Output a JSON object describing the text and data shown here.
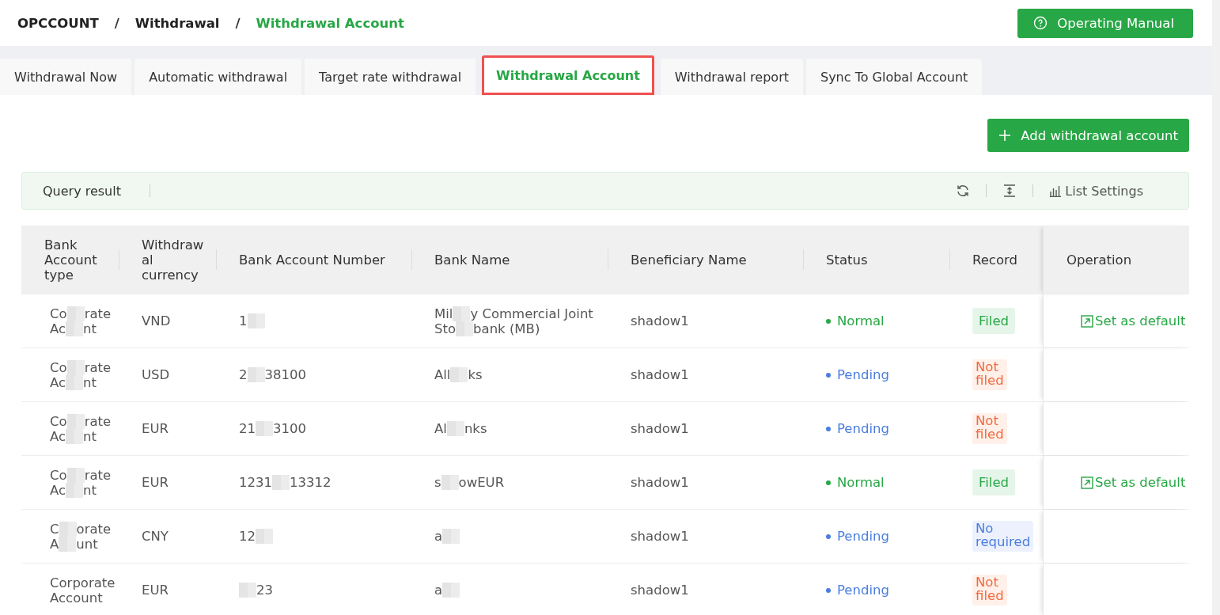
{
  "breadcrumb": [
    {
      "label": "OPCCOUNT",
      "selected": false
    },
    {
      "label": "Withdrawal",
      "selected": false
    },
    {
      "label": "Withdrawal Account",
      "selected": true
    }
  ],
  "breadcrumb_separator": "/",
  "manual_button": "Operating Manual",
  "tabs": [
    {
      "label": "Withdrawal Now",
      "selected": false,
      "highlighted": false
    },
    {
      "label": "Automatic withdrawal",
      "selected": false,
      "highlighted": false
    },
    {
      "label": "Target rate withdrawal",
      "selected": false,
      "highlighted": false
    },
    {
      "label": "Withdrawal Account",
      "selected": true,
      "highlighted": true
    },
    {
      "label": "Withdrawal report",
      "selected": false,
      "highlighted": false
    },
    {
      "label": "Sync To Global Account",
      "selected": false,
      "highlighted": false
    }
  ],
  "add_button": "Add withdrawal account",
  "toolbar": {
    "title": "Query result",
    "settings": "List Settings"
  },
  "table": {
    "columns": [
      [
        "Bank",
        "Account",
        "type"
      ],
      [
        "Withdraw",
        "al",
        "currency"
      ],
      [
        "Bank Account Number"
      ],
      [
        "Bank Name"
      ],
      [
        "Beneficiary Name"
      ],
      [
        "Status"
      ],
      [
        "Record"
      ],
      [
        "Operation"
      ]
    ],
    "rows": [
      {
        "type": [
          [
            {
              "kind": "text",
              "text": "Co"
            },
            {
              "kind": "redacted"
            },
            {
              "kind": "text",
              "text": "rate"
            }
          ],
          [
            {
              "kind": "text",
              "text": "Ac"
            },
            {
              "kind": "redacted"
            },
            {
              "kind": "text",
              "text": "nt"
            }
          ]
        ],
        "currency": "VND",
        "number": [
          [
            {
              "kind": "text",
              "text": "1"
            },
            {
              "kind": "redacted"
            }
          ]
        ],
        "bank": [
          [
            {
              "kind": "text",
              "text": "Mil"
            },
            {
              "kind": "redacted"
            },
            {
              "kind": "text",
              "text": "y Commercial Joint"
            }
          ],
          [
            {
              "kind": "text",
              "text": "Sto"
            },
            {
              "kind": "redacted"
            },
            {
              "kind": "text",
              "text": "bank (MB)"
            }
          ]
        ],
        "beneficiary": "shadow1",
        "status": {
          "kind": "normal",
          "label": "Normal"
        },
        "record": {
          "kind": "filed",
          "lines": [
            "Filed"
          ]
        },
        "operation": "Set as default"
      },
      {
        "type": [
          [
            {
              "kind": "text",
              "text": "Co"
            },
            {
              "kind": "redacted"
            },
            {
              "kind": "text",
              "text": "rate"
            }
          ],
          [
            {
              "kind": "text",
              "text": "Ac"
            },
            {
              "kind": "redacted"
            },
            {
              "kind": "text",
              "text": "nt"
            }
          ]
        ],
        "currency": "USD",
        "number": [
          [
            {
              "kind": "text",
              "text": "2"
            },
            {
              "kind": "redacted"
            },
            {
              "kind": "text",
              "text": "38100"
            }
          ]
        ],
        "bank": [
          [
            {
              "kind": "text",
              "text": "All"
            },
            {
              "kind": "redacted"
            },
            {
              "kind": "text",
              "text": "ks"
            }
          ]
        ],
        "beneficiary": "shadow1",
        "status": {
          "kind": "pending",
          "label": "Pending"
        },
        "record": {
          "kind": "not_filed",
          "lines": [
            "Not",
            "filed"
          ]
        }
      },
      {
        "type": [
          [
            {
              "kind": "text",
              "text": "Co"
            },
            {
              "kind": "redacted"
            },
            {
              "kind": "text",
              "text": "rate"
            }
          ],
          [
            {
              "kind": "text",
              "text": "Ac"
            },
            {
              "kind": "redacted"
            },
            {
              "kind": "text",
              "text": "nt"
            }
          ]
        ],
        "currency": "EUR",
        "number": [
          [
            {
              "kind": "text",
              "text": "21"
            },
            {
              "kind": "redacted"
            },
            {
              "kind": "text",
              "text": "3100"
            }
          ]
        ],
        "bank": [
          [
            {
              "kind": "text",
              "text": "Al"
            },
            {
              "kind": "redacted"
            },
            {
              "kind": "text",
              "text": "nks"
            }
          ]
        ],
        "beneficiary": "shadow1",
        "status": {
          "kind": "pending",
          "label": "Pending"
        },
        "record": {
          "kind": "not_filed",
          "lines": [
            "Not",
            "filed"
          ]
        }
      },
      {
        "type": [
          [
            {
              "kind": "text",
              "text": "Co"
            },
            {
              "kind": "redacted"
            },
            {
              "kind": "text",
              "text": "rate"
            }
          ],
          [
            {
              "kind": "text",
              "text": "Ac"
            },
            {
              "kind": "redacted"
            },
            {
              "kind": "text",
              "text": "nt"
            }
          ]
        ],
        "currency": "EUR",
        "number": [
          [
            {
              "kind": "text",
              "text": "1231"
            },
            {
              "kind": "redacted"
            },
            {
              "kind": "text",
              "text": "13312"
            }
          ]
        ],
        "bank": [
          [
            {
              "kind": "text",
              "text": "s"
            },
            {
              "kind": "redacted"
            },
            {
              "kind": "text",
              "text": "owEUR"
            }
          ]
        ],
        "beneficiary": "shadow1",
        "status": {
          "kind": "normal",
          "label": "Normal"
        },
        "record": {
          "kind": "filed",
          "lines": [
            "Filed"
          ]
        },
        "operation": "Set as default"
      },
      {
        "type": [
          [
            {
              "kind": "text",
              "text": "C"
            },
            {
              "kind": "redacted"
            },
            {
              "kind": "text",
              "text": "orate"
            }
          ],
          [
            {
              "kind": "text",
              "text": "A"
            },
            {
              "kind": "redacted"
            },
            {
              "kind": "text",
              "text": "unt"
            }
          ]
        ],
        "currency": "CNY",
        "number": [
          [
            {
              "kind": "text",
              "text": "12"
            },
            {
              "kind": "redacted"
            }
          ]
        ],
        "bank": [
          [
            {
              "kind": "text",
              "text": "a"
            },
            {
              "kind": "redacted"
            }
          ]
        ],
        "beneficiary": "shadow1",
        "status": {
          "kind": "pending",
          "label": "Pending"
        },
        "record": {
          "kind": "not_required",
          "lines": [
            "No",
            "required"
          ]
        }
      },
      {
        "type": [
          [
            {
              "kind": "text",
              "text": "Corporate"
            }
          ],
          [
            {
              "kind": "text",
              "text": "Account"
            }
          ]
        ],
        "currency": "EUR",
        "number": [
          [
            {
              "kind": "redacted"
            },
            {
              "kind": "text",
              "text": "23"
            }
          ]
        ],
        "bank": [
          [
            {
              "kind": "text",
              "text": "a"
            },
            {
              "kind": "redacted"
            }
          ]
        ],
        "beneficiary": "shadow1",
        "status": {
          "kind": "pending",
          "label": "Pending"
        },
        "record": {
          "kind": "not_filed",
          "lines": [
            "Not",
            "filed"
          ]
        }
      }
    ]
  }
}
